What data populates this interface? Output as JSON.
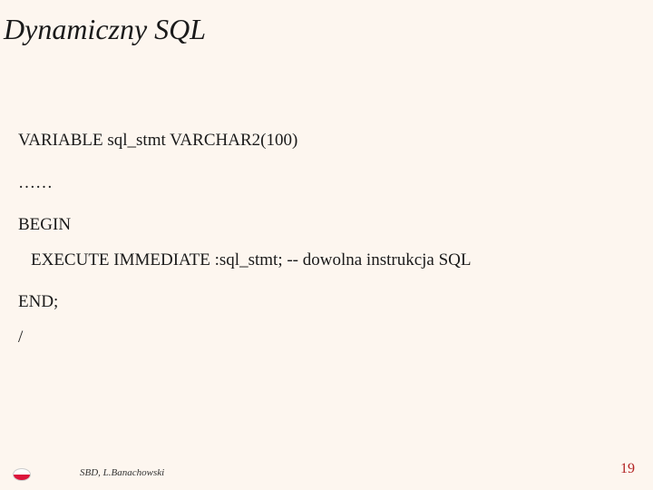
{
  "title": "Dynamiczny SQL",
  "code": {
    "l1": "VARIABLE sql_stmt    VARCHAR2(100)",
    "l2": "……",
    "l3": "BEGIN",
    "l4": "EXECUTE IMMEDIATE :sql_stmt;    -- dowolna instrukcja SQL",
    "l5": "END;",
    "l6": "/"
  },
  "footer": {
    "inst_line1": "",
    "inst_line2": "",
    "author": "SBD, L.Banachowski",
    "pagenum": "19"
  }
}
